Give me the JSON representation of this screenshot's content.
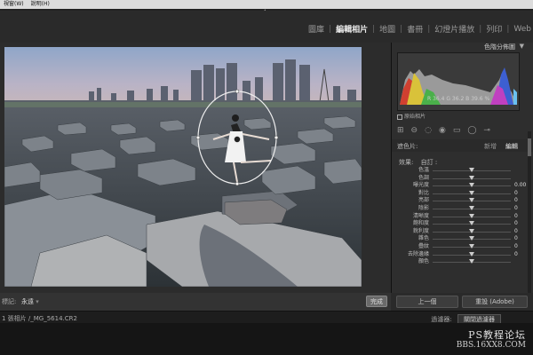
{
  "menubar": {
    "items": [
      "視窗(W)",
      "說明(H)"
    ]
  },
  "modules": {
    "items": [
      "圖庫",
      "編輯相片",
      "地圖",
      "書冊",
      "幻燈片播放",
      "列印",
      "Web"
    ],
    "active_index": 1
  },
  "histogram_panel": {
    "title": "色階分佈圖",
    "readout": "R  36.4  G  36.2  B  39.6 %",
    "original_photo_label": "原始相片"
  },
  "brush": {
    "label": "遮色片:",
    "new_label": "新增",
    "edit_label": "編輯"
  },
  "effect": {
    "label": "效果:",
    "value": "自訂 :"
  },
  "adjustments": [
    {
      "name": "色溫",
      "value": "",
      "level": 0.5
    },
    {
      "name": "色調",
      "value": "",
      "level": 0.5
    },
    {
      "name": "曝光度",
      "value": "0.00",
      "level": 0.5
    },
    {
      "name": "對比",
      "value": "0",
      "level": 0.5
    },
    {
      "name": "亮部",
      "value": "0",
      "level": 0.5
    },
    {
      "name": "陰影",
      "value": "0",
      "level": 0.5
    },
    {
      "name": "清晰度",
      "value": "0",
      "level": 0.5
    },
    {
      "name": "飽和度",
      "value": "0",
      "level": 0.5
    },
    {
      "name": "銳利度",
      "value": "0",
      "level": 0.5
    },
    {
      "name": "雜色",
      "value": "0",
      "level": 0.5
    },
    {
      "name": "疊紋",
      "value": "0",
      "level": 0.5
    },
    {
      "name": "去除邊緣",
      "value": "0",
      "level": 0.5
    },
    {
      "name": "顏色",
      "value": "",
      "level": 0.5
    }
  ],
  "toolbar": {
    "mask_label": "標記:",
    "mask_value": "永遠",
    "done_label": "完成"
  },
  "bottom_buttons": {
    "prev_label": "上一個",
    "reset_label": "重設 (Adobe)"
  },
  "filmstrip": {
    "left": "1 張相片 /_MG_5614.CR2",
    "filter_label": "過濾器:",
    "filter_value": "關閉過濾器"
  },
  "watermark": {
    "line1": "PS教程论坛",
    "line2": "BBS.16XX8.COM"
  }
}
